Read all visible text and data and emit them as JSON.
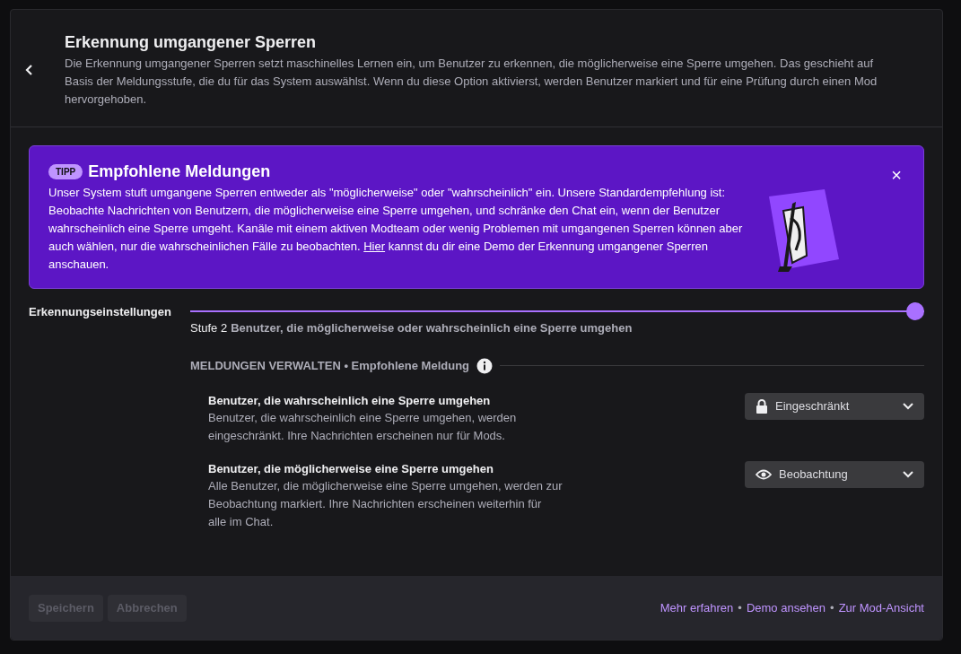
{
  "header": {
    "title": "Erkennung umgangener Sperren",
    "description": "Die Erkennung umgangener Sperren setzt maschinelles Lernen ein, um Benutzer zu erkennen, die möglicherweise eine Sperre umgehen. Das geschieht auf Basis der Meldungsstufe, die du für das System auswählst. Wenn du diese Option aktivierst, werden Benutzer markiert und für eine Prüfung durch einen Mod hervorgehoben."
  },
  "tip": {
    "badge": "TIPP",
    "title": "Empfohlene Meldungen",
    "text_before": "Unser System stuft umgangene Sperren entweder als \"möglicherweise\" oder \"wahrscheinlich\" ein. Unsere Standardempfehlung ist: Beobachte Nachrichten von Benutzern, die möglicherweise eine Sperre umgehen, und schränke den Chat ein, wenn der Benutzer wahrscheinlich eine Sperre umgeht. Kanäle mit einem aktiven Modteam oder wenig Problemen mit umgangenen Sperren können aber auch wählen, nur die wahrscheinlichen Fälle zu beobachten.",
    "link": "Hier",
    "text_after": "kannst du dir eine Demo der Erkennung umgangener Sperren anschauen.",
    "close": "×"
  },
  "detection": {
    "label": "Erkennungseinstellungen",
    "level": 1,
    "step": "Stufe 2",
    "step_description": "Benutzer, die möglicherweise oder wahrscheinlich eine Sperre umgehen"
  },
  "manage": {
    "heading": "MELDUNGEN VERWALTEN • Empfohlene Meldung",
    "rules": [
      {
        "title": "Benutzer, die wahrscheinlich eine Sperre umgehen",
        "description": "Benutzer, die wahrscheinlich eine Sperre umgehen, werden eingeschränkt. Ihre Nachrichten erscheinen nur für Mods.",
        "kind": "restricted",
        "value": "Eingeschränkt"
      },
      {
        "title": "Benutzer, die möglicherweise eine Sperre umgehen",
        "description": "Alle Benutzer, die möglicherweise eine Sperre umgehen, werden zur Beobachtung markiert. Ihre Nachrichten erscheinen weiterhin für alle im Chat.",
        "kind": "monitor",
        "value": "Beobachtung"
      }
    ]
  },
  "footer": {
    "buttons": [
      {
        "label": "Speichern",
        "disabled": true
      },
      {
        "label": "Abbrechen",
        "disabled": true
      }
    ],
    "links": [
      {
        "label": "Mehr erfahren"
      },
      {
        "label": "Demo ansehen"
      },
      {
        "label": "Zur Mod-Ansicht"
      }
    ],
    "separators": [
      "•",
      "•"
    ]
  }
}
